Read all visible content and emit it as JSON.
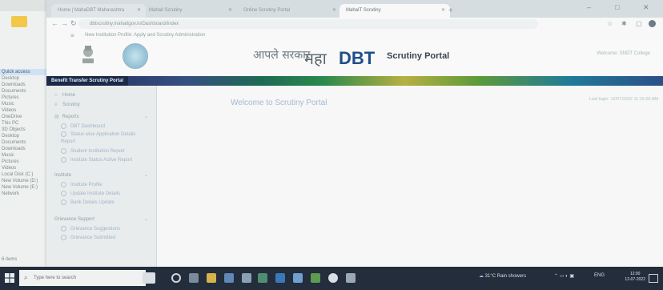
{
  "browser": {
    "tabs": [
      {
        "label": "Home | MahaDBT Maharashtra"
      },
      {
        "label": "Mahait Scrutiny"
      },
      {
        "label": "Online Scrutiny Portal"
      },
      {
        "label": "MahaIT Scrutiny"
      }
    ],
    "url": "dbtscrutiny.mahaitgov.in/Dashboard/Index",
    "bookmarks": "New Institution Profile: Apply and Scrutiny Administration",
    "window_controls": [
      "–",
      "□",
      "✕"
    ],
    "nav": {
      "back": "←",
      "forward": "→",
      "reload": "↻"
    }
  },
  "portal": {
    "logo_aaple": "आपले सरकार",
    "logo_maha": "महा",
    "logo_dbt": "DBT",
    "title": "Scrutiny Portal",
    "welcome_user": "Welcome: SNDT College",
    "banner_title": "Benefit Transfer Scrutiny Portal"
  },
  "sidebar": {
    "items": [
      {
        "label": "Home",
        "icon": "home-icon"
      },
      {
        "label": "Scrutiny",
        "icon": "list-icon"
      }
    ],
    "groups": [
      {
        "label": "Reports",
        "children": [
          "DBT Dashboard",
          "Status wise Application Details Report",
          "Student Institution Report",
          "Institute Status Active Report"
        ]
      },
      {
        "label": "Institute",
        "children": [
          "Institute Profile",
          "Update Institute Details",
          "Bank Details Update"
        ]
      },
      {
        "label": "Grievance Support",
        "children": [
          "Grievance Suggestions",
          "Grievance Submitted"
        ]
      }
    ]
  },
  "main": {
    "welcome": "Welcome to Scrutiny Portal",
    "last_login": "Last login: 12/07/2022 11:15:00 AM"
  },
  "taskbar": {
    "search_placeholder": "Type here to search",
    "weather": "31°C Rain showers",
    "lang": "ENG",
    "time": "12:00",
    "date": "12-07-2022"
  },
  "explorer": {
    "items": [
      "Quick access",
      "Desktop",
      "Downloads",
      "Documents",
      "Pictures",
      "Music",
      "Videos",
      "OneDrive",
      "This PC",
      "3D Objects",
      "Desktop",
      "Documents",
      "Downloads",
      "Music",
      "Pictures",
      "Videos",
      "Local Disk (C:)",
      "New Volume (D:)",
      "New Volume (E:)",
      "Network"
    ],
    "count": "6 items"
  },
  "colors": {
    "dbt_blue": "#1f4e8a",
    "taskbar": "#232d3b",
    "banner": "#1c2a49"
  }
}
